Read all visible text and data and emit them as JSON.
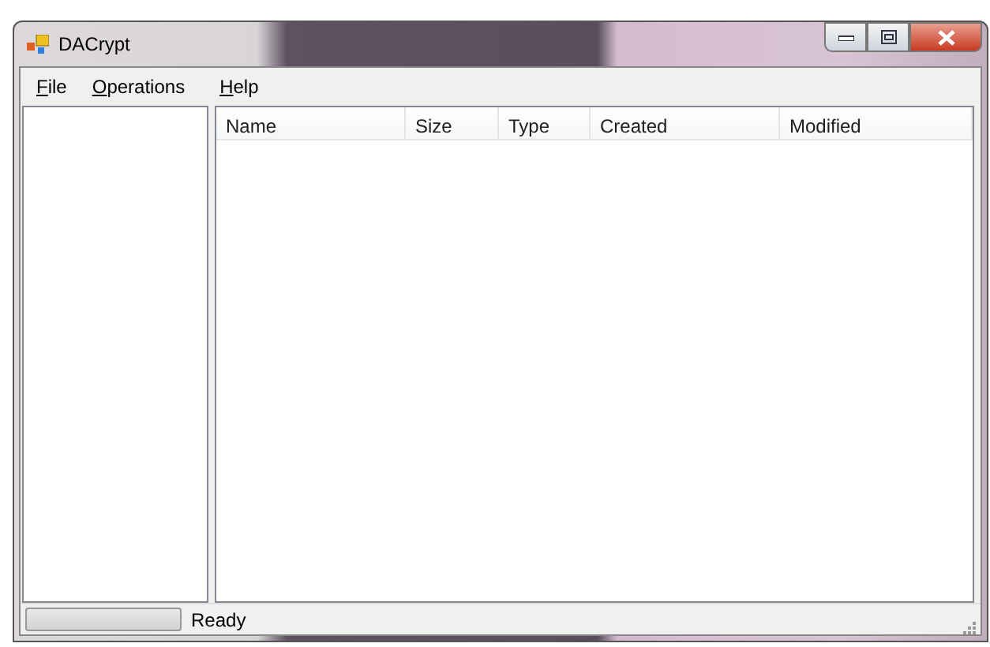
{
  "window": {
    "title": "DACrypt"
  },
  "menu": [
    {
      "label": "File"
    },
    {
      "label": "Operations"
    },
    {
      "label": "Help"
    }
  ],
  "list": {
    "columns": [
      "Name",
      "Size",
      "Type",
      "Created",
      "Modified"
    ]
  },
  "status_bar": {
    "progress": {
      "level": 0
    },
    "text": "Ready"
  }
}
